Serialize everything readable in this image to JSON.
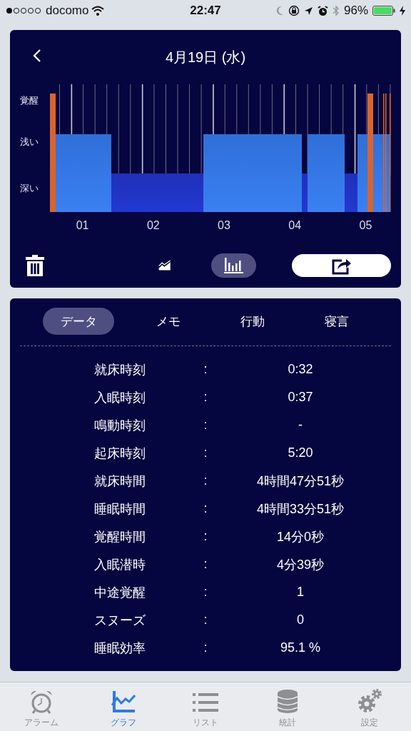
{
  "status_bar": {
    "carrier": "docomo",
    "time": "22:47",
    "battery": "96%"
  },
  "chart_card": {
    "title": "4月19日 (水)",
    "y_labels": [
      "覚醒",
      "浅い",
      "深い"
    ],
    "x_labels": [
      "01",
      "02",
      "03",
      "04",
      "05"
    ],
    "view_buttons": [
      {
        "kind": "line",
        "selected": false
      },
      {
        "kind": "bar",
        "selected": true
      }
    ]
  },
  "data_card": {
    "tabs": [
      {
        "label": "データ",
        "selected": true
      },
      {
        "label": "メモ",
        "selected": false
      },
      {
        "label": "行動",
        "selected": false
      },
      {
        "label": "寝言",
        "selected": false
      }
    ],
    "rows": [
      {
        "label": "就床時刻",
        "separator": ":",
        "value": "0:32"
      },
      {
        "label": "入眠時刻",
        "separator": ":",
        "value": "0:37"
      },
      {
        "label": "鳴動時刻",
        "separator": ":",
        "value": "-"
      },
      {
        "label": "起床時刻",
        "separator": ":",
        "value": "5:20"
      },
      {
        "label": "就床時間",
        "separator": ":",
        "value": "4時間47分51秒"
      },
      {
        "label": "睡眠時間",
        "separator": ":",
        "value": "4時間33分51秒"
      },
      {
        "label": "覚醒時間",
        "separator": ":",
        "value": "14分0秒"
      },
      {
        "label": "入眠潜時",
        "separator": ":",
        "value": "4分39秒"
      },
      {
        "label": "中途覚醒",
        "separator": ":",
        "value": "1"
      },
      {
        "label": "スヌーズ",
        "separator": ":",
        "value": "0"
      },
      {
        "label": "睡眠効率",
        "separator": ":",
        "value": "95.1 %"
      }
    ]
  },
  "tab_bar": [
    {
      "label": "アラーム",
      "kind": "alarm",
      "selected": false
    },
    {
      "label": "グラフ",
      "kind": "graph",
      "selected": true
    },
    {
      "label": "リスト",
      "kind": "list",
      "selected": false
    },
    {
      "label": "統計",
      "kind": "stats",
      "selected": false
    },
    {
      "label": "設定",
      "kind": "settings",
      "selected": false
    }
  ]
}
